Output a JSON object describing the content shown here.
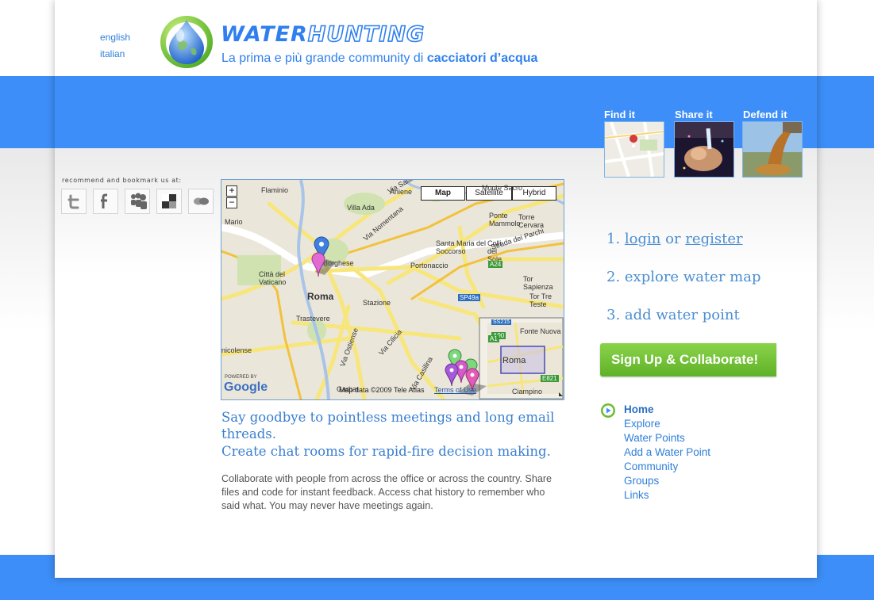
{
  "languages": [
    "english",
    "italian"
  ],
  "logo": {
    "word1": "WATER",
    "word2": "HUNTING",
    "tagline_prefix": "La prima e più grande community di",
    "tagline_bold": "cacciatori d’acqua"
  },
  "features": [
    {
      "label": "Find it"
    },
    {
      "label": "Share it"
    },
    {
      "label": "Defend it"
    }
  ],
  "social": {
    "label": "recommend and bookmark us at:",
    "icons": [
      "twitter-icon",
      "facebook-icon",
      "myspace-icon",
      "delicious-icon",
      "technorati-icon"
    ]
  },
  "map": {
    "controls": [
      "Map",
      "Satellite",
      "Hybrid"
    ],
    "zoom_in": "+",
    "zoom_out": "−",
    "labels": [
      "Flaminio",
      "Villa Ada",
      "Monte Sacro",
      "Ponte Mammolo",
      "Torre Cervara",
      "Santa Maria del Soccorso",
      "Colli del Sole",
      "Portonaccio",
      "Città del Vaticano",
      "Roma",
      "Stazione",
      "Trastevere",
      "Tor Sapienza",
      "Tor Tre Teste",
      "Strada dei Parchi",
      "Via Nomentana",
      "Via Salaria",
      "Via Ostiense",
      "Via Cilicia",
      "Via Casilina",
      "Mario",
      "Aniene",
      "Borghese",
      "nicolense",
      "Garbat",
      "A24",
      "SP49a",
      "A90",
      "A1",
      "E821",
      "SS215",
      "Fonte Nuova",
      "Ciampino",
      "Roma"
    ],
    "powered_by": "POWERED BY",
    "brand": "Google",
    "attribution": "Map data ©2009 Tele Atlas",
    "terms": "Terms of Use"
  },
  "headline": {
    "line1": "Say goodbye to pointless meetings and long email threads.",
    "line2": "Create chat rooms for rapid-fire decision making."
  },
  "body": "Collaborate with people from across the office or across the country. Share files and code for instant feedback. Access chat history to remember who said what. You may never have meetings again.",
  "steps": {
    "s1_num": "1.",
    "login": "login",
    "or": "or",
    "register": "register",
    "s2": "2. explore water map",
    "s3": "3. add water point"
  },
  "signup_button": "Sign Up & Collaborate!",
  "nav": [
    {
      "label": "Home",
      "active": true
    },
    {
      "label": "Explore"
    },
    {
      "label": "Water Points"
    },
    {
      "label": "Add a Water Point"
    },
    {
      "label": "Community"
    },
    {
      "label": "Groups"
    },
    {
      "label": "Links"
    }
  ],
  "colors": {
    "brand_blue": "#3d8ef8",
    "link_blue": "#2f7fd8",
    "signup_green": "#6cbd30"
  }
}
